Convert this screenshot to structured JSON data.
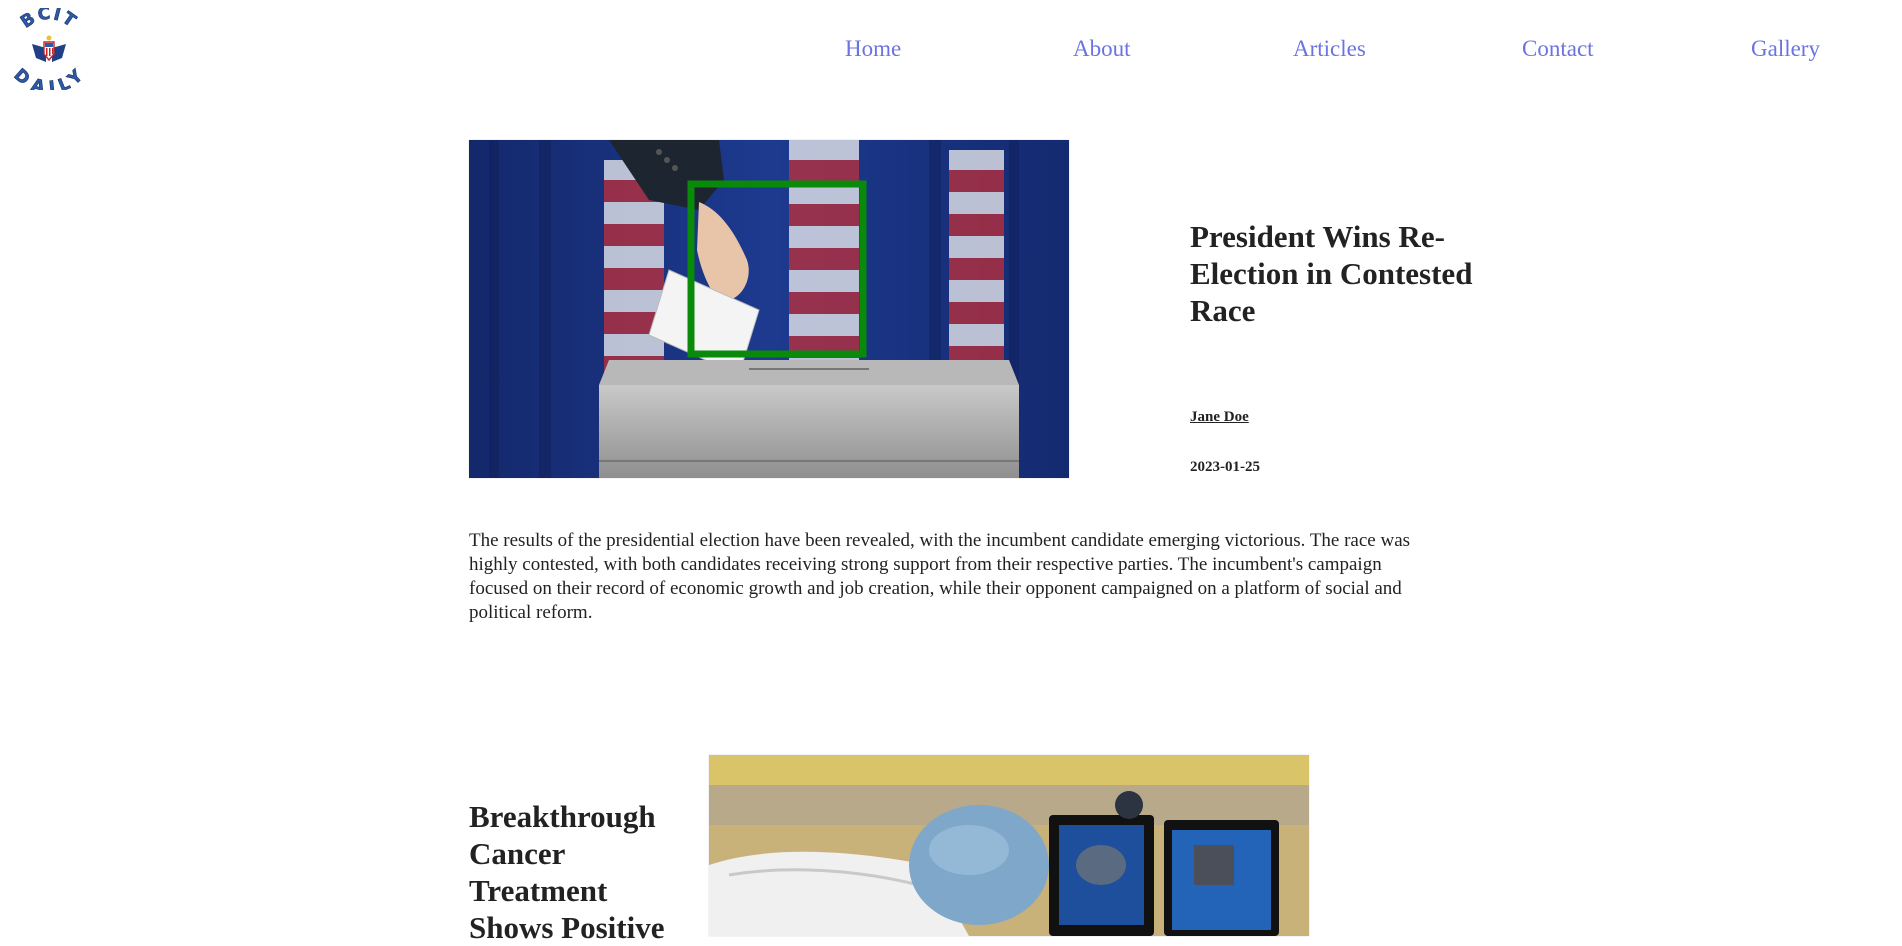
{
  "site": {
    "logo_text_top": "BCIT",
    "logo_text_bottom": "DAILY"
  },
  "nav": {
    "items": [
      {
        "label": "Home"
      },
      {
        "label": "About"
      },
      {
        "label": "Articles"
      },
      {
        "label": "Contact"
      },
      {
        "label": "Gallery"
      }
    ]
  },
  "colors": {
    "nav_link": "#6b73e0",
    "highlight_box": "#0a8a0a",
    "logo_blue": "#2d5aa8"
  },
  "articles": [
    {
      "title": "President Wins Re-Election in Contested Race",
      "author": "Jane Doe",
      "date": "2023-01-25",
      "body": "The results of the presidential election have been revealed, with the incumbent candidate emerging victorious. The race was highly contested, with both candidates receiving strong support from their respective parties. The incumbent's campaign focused on their record of economic growth and job creation, while their opponent campaigned on a platform of social and political reform.",
      "image_icon": "ballot-box-photo"
    },
    {
      "title": "Breakthrough Cancer Treatment Shows Positive",
      "image_icon": "medical-operating-room-photo"
    }
  ]
}
